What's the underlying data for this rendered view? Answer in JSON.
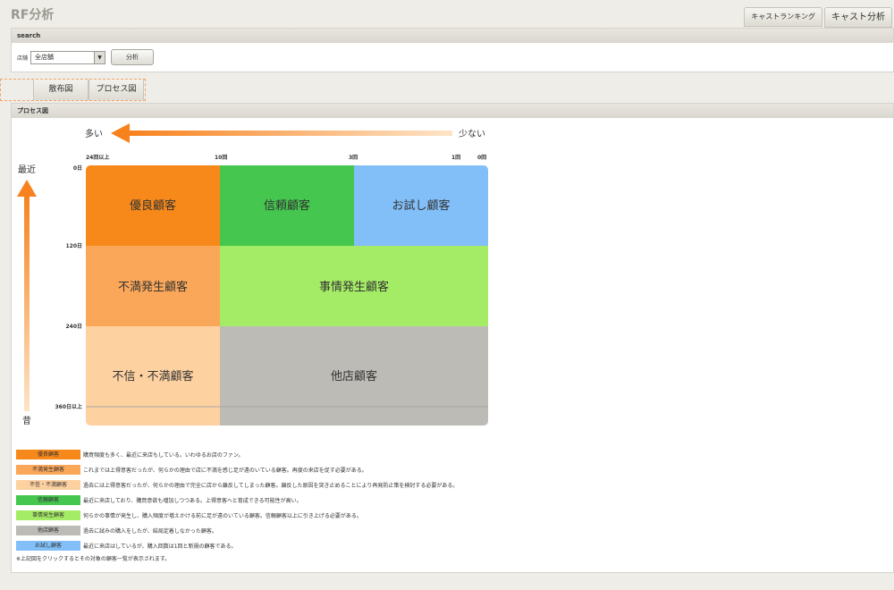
{
  "page": {
    "title": "RF分析"
  },
  "top_tabs": [
    {
      "label": "キャストランキング"
    },
    {
      "label": "キャスト分析"
    }
  ],
  "search": {
    "header": "search",
    "store_label": "店舗",
    "store_value": "全店舗",
    "analyze_label": "分析"
  },
  "view_tabs": [
    {
      "label": "散布図"
    },
    {
      "label": "プロセス図"
    }
  ],
  "process": {
    "header": "プロセス図",
    "axis": {
      "frequency_many": "多い",
      "frequency_few": "少ない",
      "recency_recent": "最近",
      "recency_old": "昔",
      "x_ticks": [
        "24回以上",
        "10回",
        "3回",
        "1回",
        "0回"
      ],
      "y_ticks": [
        "0日",
        "120日",
        "240日",
        "360日以上"
      ]
    },
    "segments": {
      "loyal": "優良顧客",
      "trust": "信頼顧客",
      "trial": "お試し顧客",
      "dissatisfied": "不満発生顧客",
      "circumstance": "事情発生顧客",
      "distrust": "不信・不満顧客",
      "other_store": "他店顧客"
    },
    "colors": {
      "arrow": "#f7821e",
      "loyal": "#f7891b",
      "trust": "#45c64f",
      "trial": "#82bff8",
      "dissatisfied": "#fba75a",
      "circumstance": "#a5ec66",
      "distrust": "#fed1a1",
      "other_store": "#bdbbb6"
    }
  },
  "legend": [
    {
      "label": "優良顧客",
      "color": "#f7891b",
      "desc": "購買頻度も多く、最近に来店もしている。いわゆるお店のファン。"
    },
    {
      "label": "不満発生顧客",
      "color": "#fba75a",
      "desc": "これまでは上得意客だったが、何らかの理由で店に不満を感じ足が遠のいている顧客。再度の来店を促す必要がある。"
    },
    {
      "label": "不信・不満顧客",
      "color": "#fed1a1",
      "desc": "過去には上得意客だったが、何らかの理由で完全に店から離反してしまった顧客。離反した原因を突き止めることにより再発防止策を検討する必要がある。"
    },
    {
      "label": "信頼顧客",
      "color": "#45c64f",
      "desc": "最近に来店しており、購買意欲も増加しつつある。上得意客へと育成できる可能性が高い。"
    },
    {
      "label": "事情発生顧客",
      "color": "#a5ec66",
      "desc": "何らかの事情が発生し、購入頻度が増えかける前に足が遠のいている顧客。信頼顧客以上に引き上げる必要がある。"
    },
    {
      "label": "他店顧客",
      "color": "#bdbbb6",
      "desc": "過去に試みの購入をしたが、結局定着しなかった顧客。"
    },
    {
      "label": "お試し顧客",
      "color": "#82bff8",
      "desc": "最近に来店はしているが、購入回数は1回と新規の顧客である。"
    }
  ],
  "note": "※上記図をクリックするとその対象の顧客一覧が表示されます。"
}
